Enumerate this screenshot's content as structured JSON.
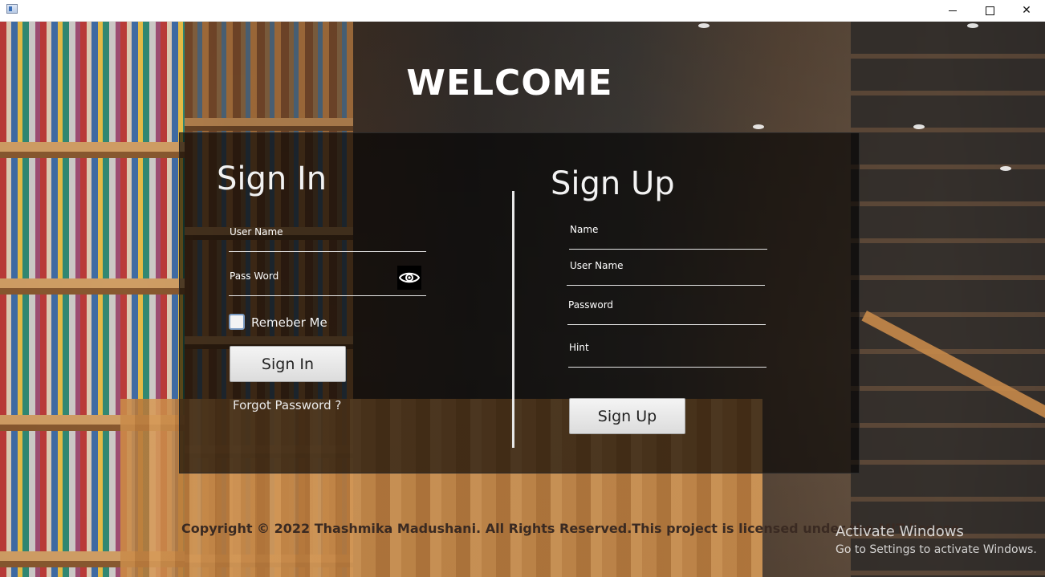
{
  "window": {
    "minimize_glyph": "minimize",
    "maximize_glyph": "maximize",
    "close_glyph": "✕"
  },
  "header": {
    "title": "WELCOME"
  },
  "sign_in": {
    "title": "Sign In",
    "username_label": "User Name",
    "password_label": "Pass Word",
    "remember_label": "Remeber Me",
    "remember_checked": false,
    "button_label": "Sign In",
    "forgot_label": "Forgot Password ?"
  },
  "sign_up": {
    "title": "Sign Up",
    "name_label": "Name",
    "username_label": "User Name",
    "password_label": "Password",
    "hint_label": "Hint",
    "button_label": "Sign Up"
  },
  "footer": {
    "copyright": "Copyright © 2022 Thashmika Madushani. All Rights Reserved.This project is licensed under the MIT license."
  },
  "watermark": {
    "title": "Activate Windows",
    "subtitle": "Go to Settings to activate Windows."
  }
}
